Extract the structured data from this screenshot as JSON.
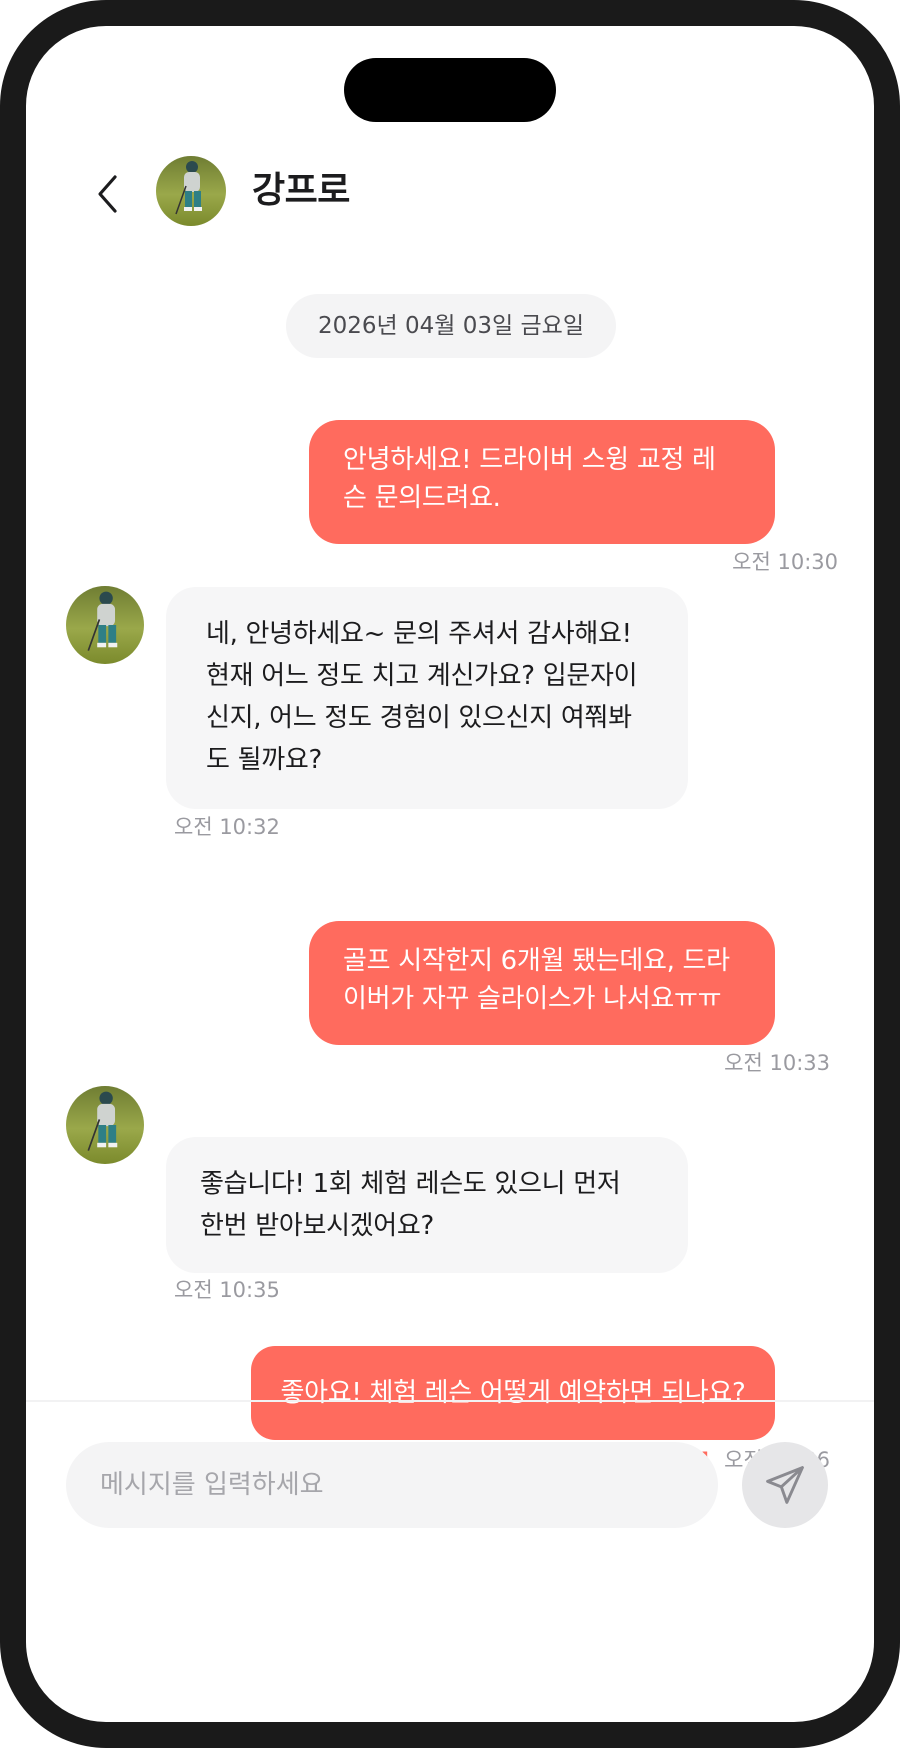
{
  "header": {
    "contact_name": "강프로"
  },
  "date_divider": "2026년 04월 03일 금요일",
  "messages": [
    {
      "from": "me",
      "text": "안녕하세요! 드라이버 스윙 교정 레슨 문의드려요.",
      "time": "오전 10:30"
    },
    {
      "from": "coach",
      "text": "네, 안녕하세요~ 문의 주셔서 감사해요! 현재 어느 정도 치고 계신가요? 입문자이신지, 어느 정도 경험이 있으신지 여쭤봐도 될까요?",
      "time": "오전 10:32"
    },
    {
      "from": "me",
      "text": "골프 시작한지 6개월 됐는데요, 드라이버가 자꾸 슬라이스가 나서요ㅠㅠ",
      "time": "오전 10:33"
    },
    {
      "from": "coach",
      "text": "좋습니다! 1회 체험 레슨도 있으니 먼저 한번 받아보시겠어요?",
      "time": "오전 10:35"
    },
    {
      "from": "me",
      "text": "좋아요! 체험 레슨 어떻게 예약하면 되나요?",
      "time": "오전 10:36",
      "unread_count": "1"
    }
  ],
  "composer": {
    "placeholder": "메시지를 입력하세요",
    "value": ""
  },
  "icons": {
    "back": "chevron-left-icon",
    "send": "paper-plane-icon",
    "avatar": "golfer-photo"
  },
  "colors": {
    "outgoing_bubble": "#ff6b5e",
    "incoming_bubble": "#f6f6f7",
    "unread": "#ff6b5e",
    "frame": "#1a1a1a"
  }
}
